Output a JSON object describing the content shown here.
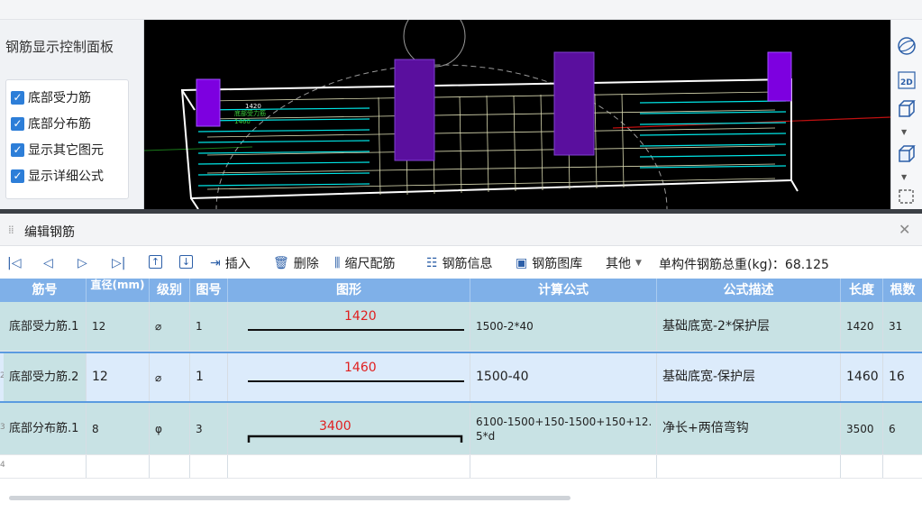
{
  "control_panel": {
    "title": "钢筋显示控制面板",
    "options": [
      {
        "label": "底部受力筋",
        "checked": true
      },
      {
        "label": "底部分布筋",
        "checked": true
      },
      {
        "label": "显示其它图元",
        "checked": true
      },
      {
        "label": "显示详细公式",
        "checked": true
      }
    ]
  },
  "viewport": {
    "labels": [
      "1420",
      "底部受力筋",
      "1460"
    ],
    "colors": {
      "background": "#000000",
      "rebar": "#00e5e5",
      "mesh": "#d8d8b0",
      "column": "#7d00e0",
      "frame": "#ffffff"
    }
  },
  "view_toolbar": {
    "icons": [
      "orbit-icon",
      "2d-view-icon",
      "3d-box-icon",
      "3d-solid-icon",
      "dashed-box-icon"
    ],
    "label_2d": "2D"
  },
  "edit_panel": {
    "title": "编辑钢筋",
    "toolbar": {
      "insert": "插入",
      "delete": "删除",
      "scale": "缩尺配筋",
      "info": "钢筋信息",
      "library": "钢筋图库",
      "other": "其他",
      "total": "单构件钢筋总重(kg)：68.125"
    },
    "columns": [
      "筋号",
      "直径(mm)",
      "级别",
      "图号",
      "图形",
      "计算公式",
      "公式描述",
      "长度",
      "根数"
    ],
    "rows": [
      {
        "name": "底部受力筋.1",
        "diameter": "12",
        "grade": "⌀",
        "figure": "1",
        "shape_value": "1420",
        "formula": "1500-2*40",
        "desc": "基础底宽-2*保护层",
        "length": "1420",
        "count": "31",
        "marker": ""
      },
      {
        "name": "底部受力筋.2",
        "diameter": "12",
        "grade": "⌀",
        "figure": "1",
        "shape_value": "1460",
        "formula": "1500-40",
        "desc": "基础底宽-保护层",
        "length": "1460",
        "count": "16",
        "marker": "2"
      },
      {
        "name": "底部分布筋.1",
        "diameter": "8",
        "grade": "φ",
        "figure": "3",
        "shape_value": "3400",
        "formula": "6100-1500+150-1500+150+12.5*d",
        "desc": "净长+两倍弯钩",
        "length": "3500",
        "count": "6",
        "marker": "3"
      },
      {
        "name": "",
        "diameter": "",
        "grade": "",
        "figure": "",
        "shape_value": "",
        "formula": "",
        "desc": "",
        "length": "",
        "count": "",
        "marker": "4"
      }
    ],
    "colors": {
      "header": "#7fb0e8",
      "row_teal": "#c8e2e4",
      "row_selected": "#dcebfb",
      "selected_border": "#5b9be0",
      "accent": "#2c5fa8",
      "shape_text": "#e02020"
    }
  }
}
